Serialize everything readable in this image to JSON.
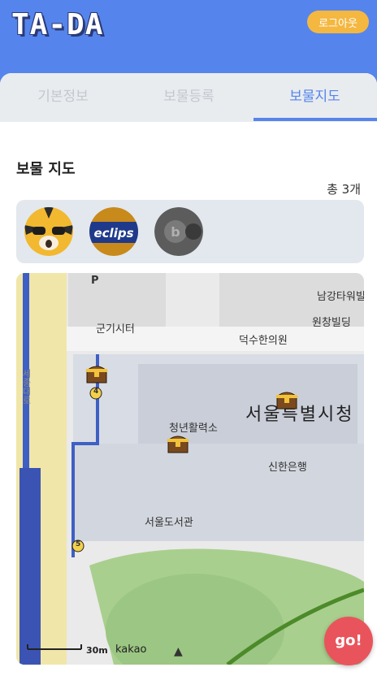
{
  "header": {
    "logo_text": "TA-DA",
    "logout_label": "로그아웃"
  },
  "tabs": [
    {
      "label": "기본정보",
      "active": false
    },
    {
      "label": "보물등록",
      "active": false
    },
    {
      "label": "보물지도",
      "active": true
    }
  ],
  "treasure_map": {
    "title": "보물 지도",
    "count_label": "총 3개",
    "treasures": [
      {
        "name": "tiger-character-image"
      },
      {
        "name": "eclipse-candy-image"
      },
      {
        "name": "beats-earbuds-image"
      }
    ]
  },
  "map": {
    "labels": {
      "parking": "P",
      "gungisiter": "군기시터",
      "deoksu": "덕수한의원",
      "namgang": "남강타워빌",
      "wonchang": "원창빌딩",
      "cityhall": "서울특별시청",
      "youth": "청년활력소",
      "shinhan": "신한은행",
      "library": "서울도서관",
      "road": "세종대로",
      "exit4": "4",
      "exit5": "5"
    },
    "scale_label": "30m",
    "provider": "kakao",
    "go_label": "go!"
  },
  "colors": {
    "primary": "#5585ec",
    "accent_yellow": "#f4b740",
    "go_red": "#e9545c"
  }
}
